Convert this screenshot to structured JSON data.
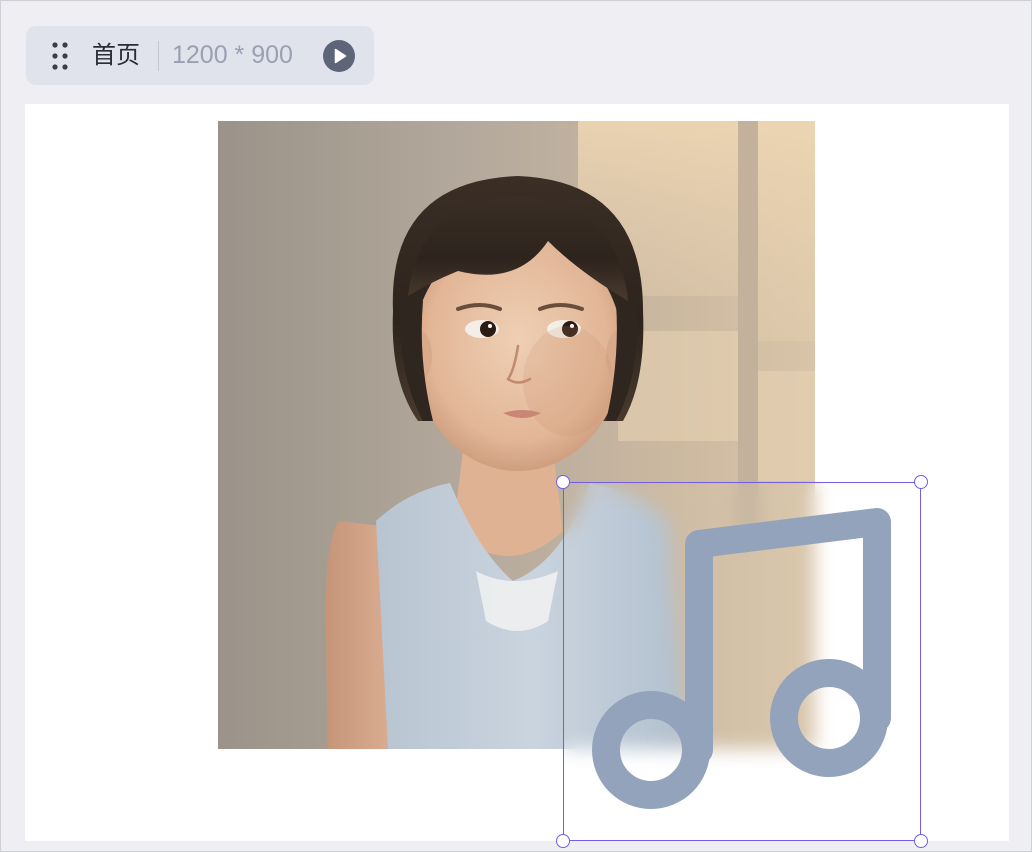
{
  "toolbar": {
    "page_name": "首页",
    "page_size": "1200 * 900"
  },
  "icons": {
    "drag": "drag-handle-icon",
    "play": "play-icon",
    "music": "music-note-icon"
  },
  "colors": {
    "selection": "#6f5fe8",
    "note_fill": "#93a3bb",
    "chip_bg": "#e1e3ec",
    "workspace_bg": "#eeeef3"
  }
}
